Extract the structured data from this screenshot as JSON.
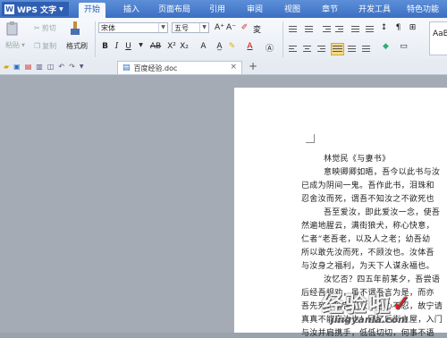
{
  "app": {
    "title": "WPS 文字"
  },
  "menu": [
    "开始",
    "插入",
    "页面布局",
    "引用",
    "审阅",
    "视图",
    "章节",
    "开发工具",
    "特色功能"
  ],
  "ribbon": {
    "paste": "粘贴",
    "cut": "剪切",
    "copy": "复制",
    "format_painter": "格式刷",
    "font_name": "宋体",
    "font_size": "五号",
    "style_preview": "AaBb"
  },
  "tab": {
    "filename": "百度经验.doc"
  },
  "document": {
    "lines": [
      "林觉民《与妻书》",
      "意映卿卿如晤，吾今以此书与汝",
      "已成为阴间一鬼。吾作此书，泪珠和",
      "忍舍汝而死，谓吾不知汝之不欲死也",
      "吾至爱汝，即此爱汝一念，使吾",
      "然遍地腥云，满街狼犬，称心快意，",
      "仁者“老吾老，以及人之老；幼吾幼",
      "所以敢先汝而死，不顾汝也。汝体吾",
      "与汝身之福利，为天下人谋永福也。",
      "汝忆否？四五年前某夕，吾尝语",
      "后经吾规劝，虽不谓吾言为是，而亦",
      "吾先死，留苦与汝，吾心不忍，故宁请",
      "真真不能忘汝也！回忆后街之屋，入门",
      "与汝并肩携手，低低切切，何事不语"
    ]
  },
  "watermark": {
    "main": "经验啦",
    "check": "✓",
    "url": "jingyanla.com"
  }
}
